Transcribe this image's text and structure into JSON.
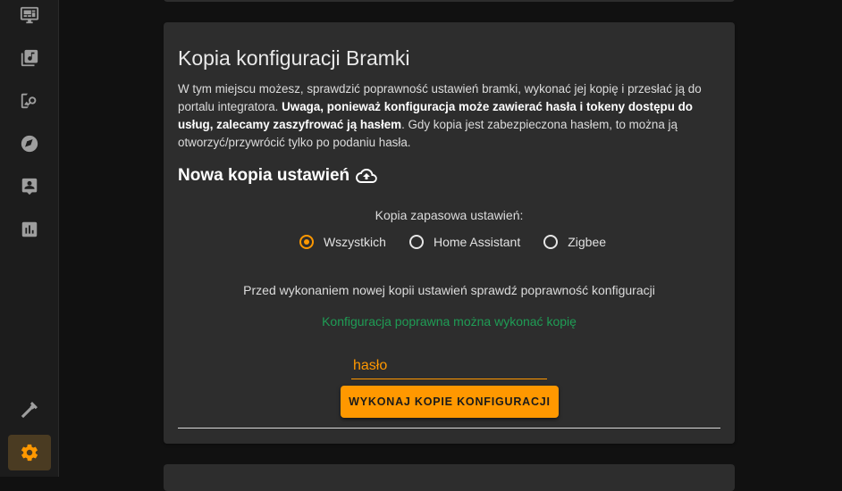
{
  "sidebar": {
    "items": [
      {
        "icon": "monitor-dashboard-icon"
      },
      {
        "icon": "music-library-icon"
      },
      {
        "icon": "image-search-icon"
      },
      {
        "icon": "compass-icon"
      },
      {
        "icon": "account-box-icon"
      },
      {
        "icon": "chart-box-icon"
      }
    ],
    "bottom_items": [
      {
        "icon": "hammer-icon"
      },
      {
        "icon": "gear-icon",
        "active": true
      }
    ]
  },
  "backup_card": {
    "title": "Kopia konfiguracji Bramki",
    "description_part1": "W tym miejscu możesz, sprawdzić poprawność ustawień bramki, wykonać jej kopię i przesłać ją do portalu integratora. ",
    "description_bold": "Uwaga, ponieważ konfiguracja może zawierać hasła i tokeny dostępu do usług, zalecamy zaszyfrować ją hasłem",
    "description_part2": ". Gdy kopia jest zabezpieczona hasłem, to można ją otworzyć/przywrócić tylko po podaniu hasła.",
    "section_title": "Nowa kopia ustawień",
    "section_icon": "cloud-upload-icon",
    "radio_label": "Kopia zapasowa ustawień:",
    "radio_options": [
      {
        "label": "Wszystkich",
        "checked": true
      },
      {
        "label": "Home Assistant",
        "checked": false
      },
      {
        "label": "Zigbee",
        "checked": false
      }
    ],
    "check_text": "Przed wykonaniem nowej kopii ustawień sprawdź poprawność konfiguracji",
    "status_text": "Konfiguracja poprawna można wykonać kopię",
    "password_value": "hasło",
    "button_label": "WYKONAJ KOPIE KONFIGURACJI"
  },
  "colors": {
    "accent": "#ff9800",
    "success": "#1f9d55",
    "card_bg": "#2d2d2d",
    "sidebar_bg": "#1c1c1c"
  }
}
